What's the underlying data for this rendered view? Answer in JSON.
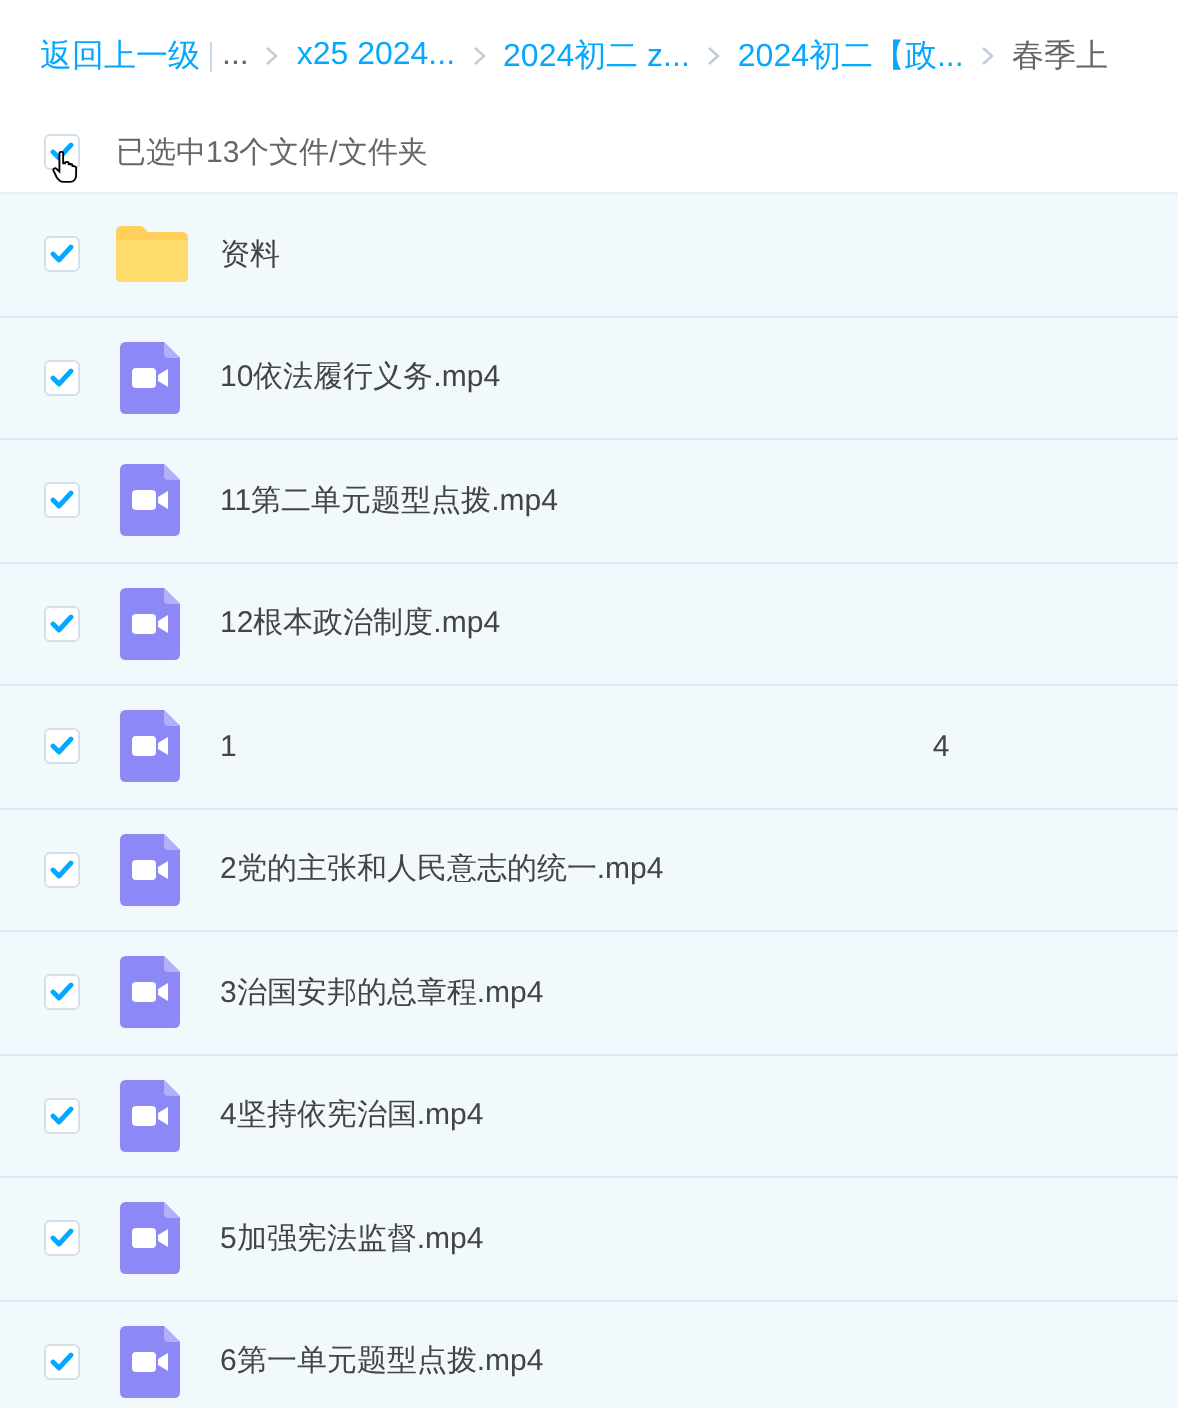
{
  "breadcrumb": [
    {
      "label": "返回上一级",
      "kind": "link"
    },
    {
      "label": "...",
      "kind": "plain"
    },
    {
      "label": "x25 2024...",
      "kind": "link"
    },
    {
      "label": "2024初二 z...",
      "kind": "link"
    },
    {
      "label": "2024初二【政...",
      "kind": "link"
    },
    {
      "label": "春季上",
      "kind": "current"
    }
  ],
  "select_all": {
    "checked": true,
    "label": "已选中13个文件/文件夹"
  },
  "files": [
    {
      "kind": "folder",
      "name": "资料",
      "checked": true,
      "selected": true
    },
    {
      "kind": "video",
      "name": "10依法履行义务.mp4",
      "checked": true,
      "selected": true
    },
    {
      "kind": "video",
      "name": "11第二单元题型点拨.mp4",
      "checked": true,
      "selected": true
    },
    {
      "kind": "video",
      "name": "12根本政治制度.mp4",
      "checked": true,
      "selected": true
    },
    {
      "kind": "video",
      "name": "1",
      "name_end": "4",
      "checked": true,
      "selected": true
    },
    {
      "kind": "video",
      "name": "2党的主张和人民意志的统一.mp4",
      "checked": true,
      "selected": true
    },
    {
      "kind": "video",
      "name": "3治国安邦的总章程.mp4",
      "checked": true,
      "selected": true
    },
    {
      "kind": "video",
      "name": "4坚持依宪治国.mp4",
      "checked": true,
      "selected": true
    },
    {
      "kind": "video",
      "name": "5加强宪法监督.mp4",
      "checked": true,
      "selected": true
    },
    {
      "kind": "video",
      "name": "6第一单元题型点拨.mp4",
      "checked": true,
      "selected": true
    }
  ]
}
